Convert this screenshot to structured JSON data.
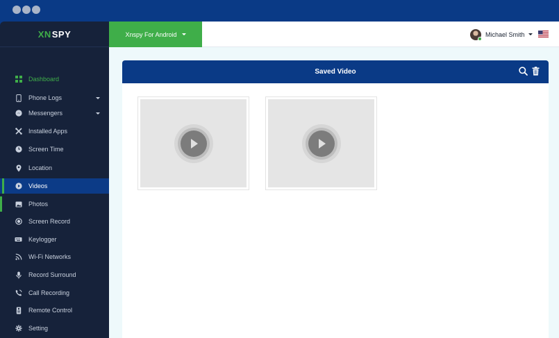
{
  "brand": {
    "logo_xn": "XN",
    "logo_spy": "SPY"
  },
  "topbar": {
    "device_label": "Xnspy For Android",
    "user_name": "Michael Smith",
    "flag": "us-flag-icon"
  },
  "sidebar": {
    "items": [
      {
        "label": "Dashboard",
        "icon": "dashboard-icon"
      },
      {
        "label": "Phone Logs",
        "icon": "phone-icon",
        "has_submenu": true
      },
      {
        "label": "Messengers",
        "icon": "messenger-icon",
        "has_submenu": true
      },
      {
        "label": "Installed Apps",
        "icon": "apps-icon"
      },
      {
        "label": "Screen Time",
        "icon": "clock-icon"
      },
      {
        "label": "Location",
        "icon": "location-pin-icon"
      },
      {
        "label": "Videos",
        "icon": "play-circle-icon",
        "active": true
      },
      {
        "label": "Photos",
        "icon": "image-icon"
      },
      {
        "label": "Screen Record",
        "icon": "record-icon"
      },
      {
        "label": "Keylogger",
        "icon": "keyboard-icon"
      },
      {
        "label": "Wi-Fi Networks",
        "icon": "wifi-icon"
      },
      {
        "label": "Record Surround",
        "icon": "microphone-icon"
      },
      {
        "label": "Call Recording",
        "icon": "phone-call-icon"
      },
      {
        "label": "Remote Control",
        "icon": "remote-icon"
      },
      {
        "label": "Setting",
        "icon": "gear-icon"
      }
    ]
  },
  "main": {
    "title": "Saved Video",
    "videos": [
      {
        "type": "video-thumbnail"
      },
      {
        "type": "video-thumbnail"
      }
    ]
  },
  "colors": {
    "brand_blue": "#0a3a86",
    "accent_green": "#3fae49",
    "sidebar_bg": "#16223a"
  }
}
